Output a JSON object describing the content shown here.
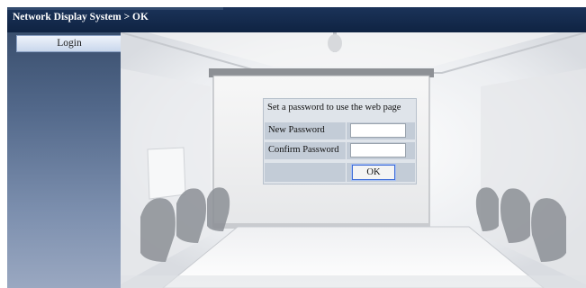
{
  "header": {
    "title": "Network Display System > OK"
  },
  "sidebar": {
    "items": [
      {
        "label": "Login"
      }
    ]
  },
  "dialog": {
    "title": "Set a password to use the web page",
    "fields": [
      {
        "label": "New Password",
        "value": "",
        "placeholder": ""
      },
      {
        "label": "Confirm Password",
        "value": "",
        "placeholder": ""
      }
    ],
    "ok_label": "OK"
  },
  "colors": {
    "header_bg": "#0f2342",
    "sidebar_bg": "#52688a",
    "dialog_bg": "#dfe4ea",
    "focus_ring": "#3d6bd6"
  }
}
